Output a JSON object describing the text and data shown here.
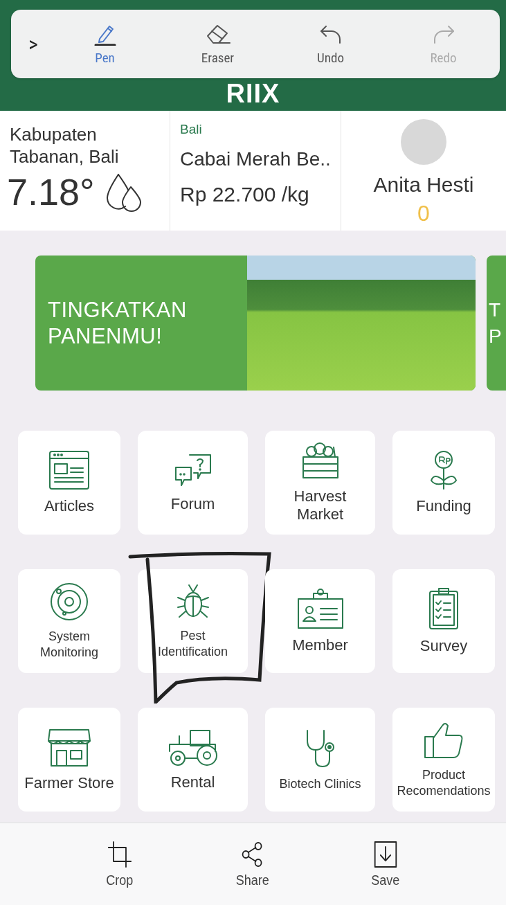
{
  "markup_toolbar": {
    "expand_glyph": ">",
    "tools": [
      {
        "label": "Pen",
        "kind": "pen",
        "selected": true,
        "disabled": false
      },
      {
        "label": "Eraser",
        "kind": "eraser",
        "selected": false,
        "disabled": false
      },
      {
        "label": "Undo",
        "kind": "undo",
        "selected": false,
        "disabled": false
      },
      {
        "label": "Redo",
        "kind": "redo",
        "selected": false,
        "disabled": true
      }
    ]
  },
  "header": {
    "logo": "RIIX"
  },
  "weather": {
    "location": "Kabupaten Tabanan, Bali",
    "temperature": "7.18°"
  },
  "price": {
    "region": "Bali",
    "commodity": "Cabai Merah Be..",
    "price": "Rp 22.700 /kg"
  },
  "profile": {
    "name": "Anita Hesti",
    "points": "0"
  },
  "banners": [
    {
      "lines": [
        "TINGKATKAN",
        "PANENMU!"
      ]
    },
    {
      "lines": [
        "T",
        "P"
      ]
    }
  ],
  "menu": [
    {
      "label": "Articles",
      "kind": "articles",
      "annotated": false
    },
    {
      "label": "Forum",
      "kind": "forum",
      "annotated": false
    },
    {
      "label": "Harvest Market",
      "kind": "market",
      "annotated": false
    },
    {
      "label": "Funding",
      "kind": "funding",
      "annotated": false
    },
    {
      "label": "System Monitoring",
      "kind": "monitoring",
      "annotated": false
    },
    {
      "label": "Pest Identification",
      "kind": "pest",
      "annotated": true
    },
    {
      "label": "Member",
      "kind": "member",
      "annotated": false
    },
    {
      "label": "Survey",
      "kind": "survey",
      "annotated": false
    },
    {
      "label": "Farmer Store",
      "kind": "store",
      "annotated": false
    },
    {
      "label": "Rental",
      "kind": "tractor",
      "annotated": false
    },
    {
      "label": "Biotech Clinics",
      "kind": "stethoscope",
      "annotated": false
    },
    {
      "label": "Product Recomendations",
      "kind": "thumb",
      "annotated": false
    }
  ],
  "edit_actions": [
    {
      "label": "Crop",
      "kind": "crop"
    },
    {
      "label": "Share",
      "kind": "share"
    },
    {
      "label": "Save",
      "kind": "save"
    }
  ]
}
